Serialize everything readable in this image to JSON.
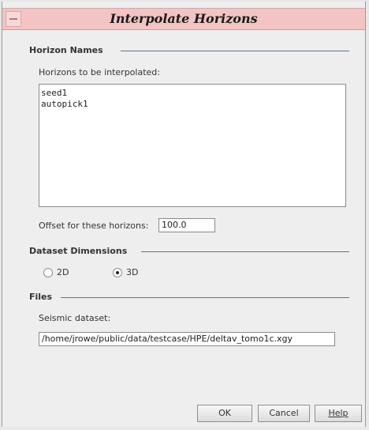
{
  "window": {
    "title": "Interpolate Horizons"
  },
  "horizon_names": {
    "section_title": "Horizon Names",
    "list_label": "Horizons to be interpolated:",
    "items": [
      "seed1",
      "autopick1"
    ],
    "offset_label": "Offset for these horizons:",
    "offset_value": "100.0"
  },
  "dataset_dimensions": {
    "section_title": "Dataset Dimensions",
    "options": [
      {
        "label": "2D",
        "selected": false
      },
      {
        "label": "3D",
        "selected": true
      }
    ]
  },
  "files": {
    "section_title": "Files",
    "seismic_label": "Seismic dataset:",
    "seismic_value": "/home/jrowe/public/data/testcase/HPE/deltav_tomo1c.xgy"
  },
  "buttons": {
    "ok": "OK",
    "cancel": "Cancel",
    "help": "Help"
  }
}
